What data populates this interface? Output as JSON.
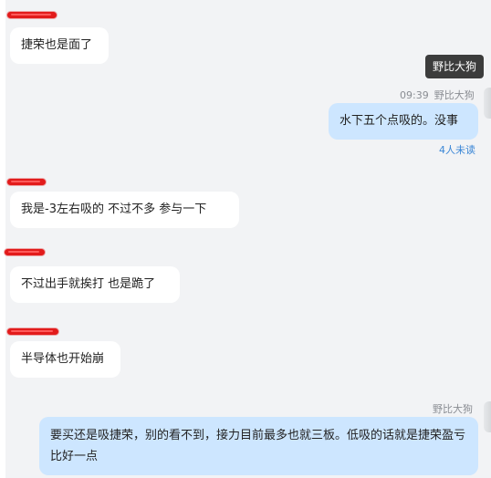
{
  "tooltip": "野比大狗",
  "messages": [
    {
      "text": "捷荣也是面了"
    },
    {
      "sender": "野比大狗",
      "time": "09:39",
      "text": "水下五个点吸的。没事",
      "unread": "4人未读"
    },
    {
      "text": "我是-3左右吸的   不过不多 参与一下"
    },
    {
      "text": "不过出手就挨打  也是跪了"
    },
    {
      "text": "半导体也开始崩"
    },
    {
      "sender": "野比大狗",
      "text": "要买还是吸捷荣，别的看不到，接力目前最多也就三板。低吸的话就是捷荣盈亏比好一点"
    }
  ],
  "colors": {
    "background": "#f2f3f5",
    "incoming_bubble": "#ffffff",
    "outgoing_bubble": "#cde6ff",
    "unread": "#3a86d6",
    "redaction": "#e21b1b"
  }
}
